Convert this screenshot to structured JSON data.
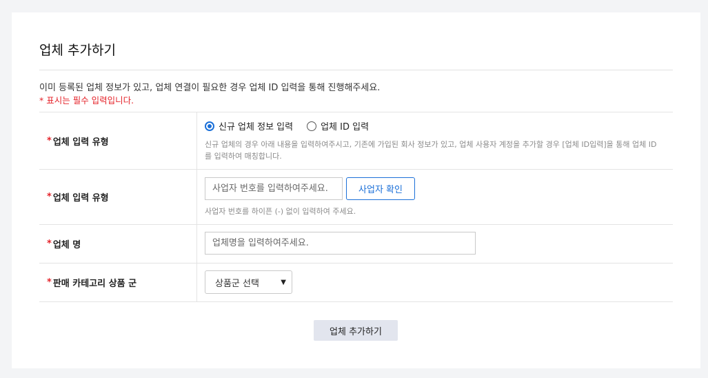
{
  "page": {
    "title": "업체 추가하기",
    "description": "이미 등록된 업체 정보가 있고, 업체 연결이 필요한 경우 업체 ID 입력을 통해 진행해주세요.",
    "required_note": "* 표시는 필수 입력입니다."
  },
  "form": {
    "required_mark": "*",
    "type_row": {
      "label": "업체 입력 유형",
      "options": [
        {
          "label": "신규 업체 정보 입력",
          "selected": true
        },
        {
          "label": "업체 ID 입력",
          "selected": false
        }
      ],
      "help": "신규 업체의 경우 아래 내용을 입력하여주시고, 기존에 가입된 회사 정보가 있고, 업체 사용자 계정을 추가할 경우 [업체 ID입력]을 통해 업체 ID를 입력하여 매칭합니다."
    },
    "biz_row": {
      "label": "업체 입력 유형",
      "placeholder": "사업자 번호를 입력하여주세요.",
      "confirm_button": "사업자 확인",
      "help": "사업자 번호를 하이픈 (-) 없이 입력하여 주세요."
    },
    "name_row": {
      "label": "업체 명",
      "placeholder": "업체명을 입력하여주세요."
    },
    "category_row": {
      "label": "판매 카테고리 상품 군",
      "selected": "상품군 선택",
      "chevron_icon": "chevron-down-icon"
    }
  },
  "submit_label": "업체 추가하기",
  "colors": {
    "accent": "#1a6fd8",
    "required": "#e5242b",
    "submit_bg": "#e2e5ee"
  }
}
